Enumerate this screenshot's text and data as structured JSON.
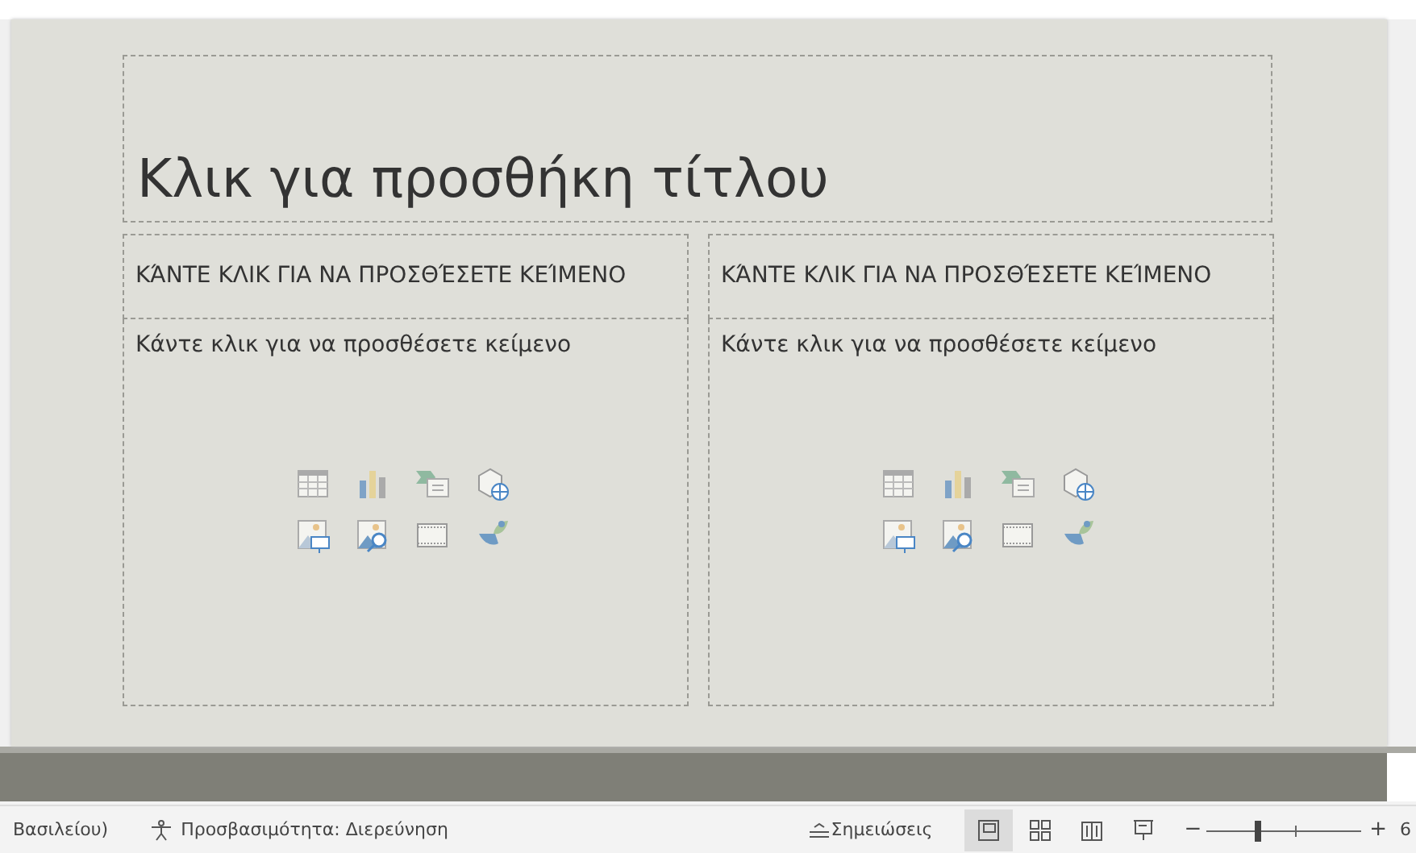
{
  "slide": {
    "title": "Κλικ για προσθήκη τίτλου",
    "columns": [
      {
        "heading": "ΚΆΝΤΕ ΚΛΙΚ ΓΙΑ ΝΑ ΠΡΟΣΘΈΣΕΤΕ ΚΕΊΜΕΝΟ",
        "body": "Κάντε κλικ για να προσθέσετε κείμενο"
      },
      {
        "heading": "ΚΆΝΤΕ ΚΛΙΚ ΓΙΑ ΝΑ ΠΡΟΣΘΈΣΕΤΕ ΚΕΊΜΕΝΟ",
        "body": "Κάντε κλικ για να προσθέσετε κείμενο"
      }
    ]
  },
  "status_bar": {
    "language": "Βασιλείου)",
    "accessibility": "Προσβασιμότητα: Διερεύνηση",
    "notes": "Σημειώσεις",
    "views": [
      {
        "kind": "normal",
        "selected": true
      },
      {
        "kind": "sorter",
        "selected": false
      },
      {
        "kind": "reading",
        "selected": false
      },
      {
        "kind": "slideshow",
        "selected": false
      }
    ],
    "zoom": {
      "minus": "−",
      "plus": "+",
      "level": 0.33,
      "percent": "6"
    }
  }
}
